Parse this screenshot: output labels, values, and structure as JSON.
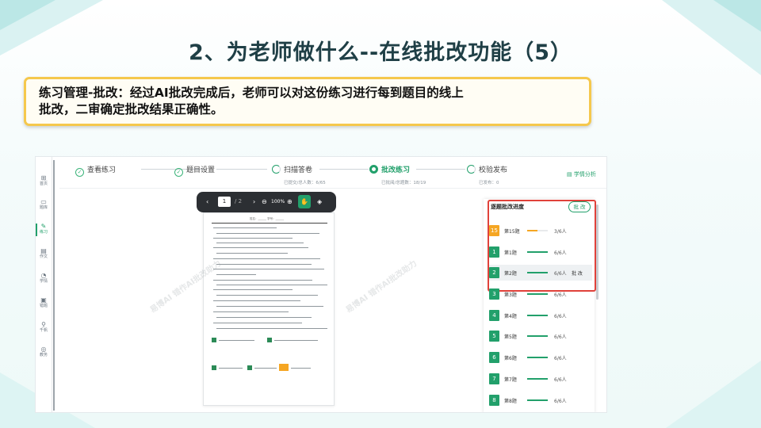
{
  "slide": {
    "title": "2、为老师做什么--在线批改功能（5）",
    "callout_line1": "练习管理-批改：经过AI批改完成后，老师可以对这份练习进行每到题目的线上",
    "callout_line2": "批改，二审确定批改结果正确性。"
  },
  "sidebar": {
    "items": [
      {
        "icon": "grid-icon",
        "glyph": "⊞",
        "label": "首页"
      },
      {
        "icon": "folder-icon",
        "glyph": "▭",
        "label": "题库"
      },
      {
        "icon": "pen-icon",
        "glyph": "✎",
        "label": "练习"
      },
      {
        "icon": "document-icon",
        "glyph": "▤",
        "label": "作文"
      },
      {
        "icon": "chart-icon",
        "glyph": "◔",
        "label": "学情"
      },
      {
        "icon": "book-icon",
        "glyph": "▣",
        "label": "错题"
      },
      {
        "icon": "search-icon",
        "glyph": "⚲",
        "label": "千帆"
      },
      {
        "icon": "settings-icon",
        "glyph": "◎",
        "label": "教务"
      }
    ]
  },
  "steps": [
    {
      "label": "查看练习",
      "icon": "check-circle-icon",
      "glyph": "✓",
      "sub": ""
    },
    {
      "label": "题目设置",
      "icon": "check-circle-icon",
      "glyph": "✓",
      "sub": ""
    },
    {
      "label": "扫描答卷",
      "icon": "loading-circle-icon",
      "glyph": "",
      "sub": "已提交/总人数：6/65"
    },
    {
      "label": "批改练习",
      "icon": "current-circle-icon",
      "glyph": "",
      "sub": "已批阅/总题数：18/19"
    },
    {
      "label": "校验发布",
      "icon": "loading-circle-icon",
      "glyph": "",
      "sub": "已发布：0"
    }
  ],
  "analysis_link": "学情分析",
  "toolbar": {
    "prev": "‹",
    "page": "1",
    "total": "/ 2",
    "next": "›",
    "zoom_out": "⊖",
    "zoom": "100%",
    "zoom_in": "⊕",
    "hand": "✋",
    "target": "◈"
  },
  "document": {
    "header": "姓名：______ 学号：______",
    "watermark": "易博AI 错作AI批改助力"
  },
  "progress_panel": {
    "title": "逐题批改进度",
    "button": "批 改",
    "rows": [
      {
        "no": "15",
        "name": "第15题",
        "count": "3/6人",
        "status": "partial",
        "action": ""
      },
      {
        "no": "1",
        "name": "第1题",
        "count": "6/6人",
        "status": "done",
        "action": ""
      },
      {
        "no": "2",
        "name": "第2题",
        "count": "6/6人",
        "status": "done",
        "action": "批 改"
      },
      {
        "no": "3",
        "name": "第3题",
        "count": "6/6人",
        "status": "done",
        "action": ""
      },
      {
        "no": "4",
        "name": "第4题",
        "count": "6/6人",
        "status": "done",
        "action": ""
      },
      {
        "no": "5",
        "name": "第5题",
        "count": "6/6人",
        "status": "done",
        "action": ""
      },
      {
        "no": "6",
        "name": "第6题",
        "count": "6/6人",
        "status": "done",
        "action": ""
      },
      {
        "no": "7",
        "name": "第7题",
        "count": "6/6人",
        "status": "done",
        "action": ""
      },
      {
        "no": "8",
        "name": "第8题",
        "count": "6/6人",
        "status": "done",
        "action": ""
      }
    ]
  },
  "colors": {
    "accent": "#22a06b",
    "warning": "#f5a623",
    "highlight_border": "#e0413a",
    "callout_border": "#f5c84c"
  }
}
